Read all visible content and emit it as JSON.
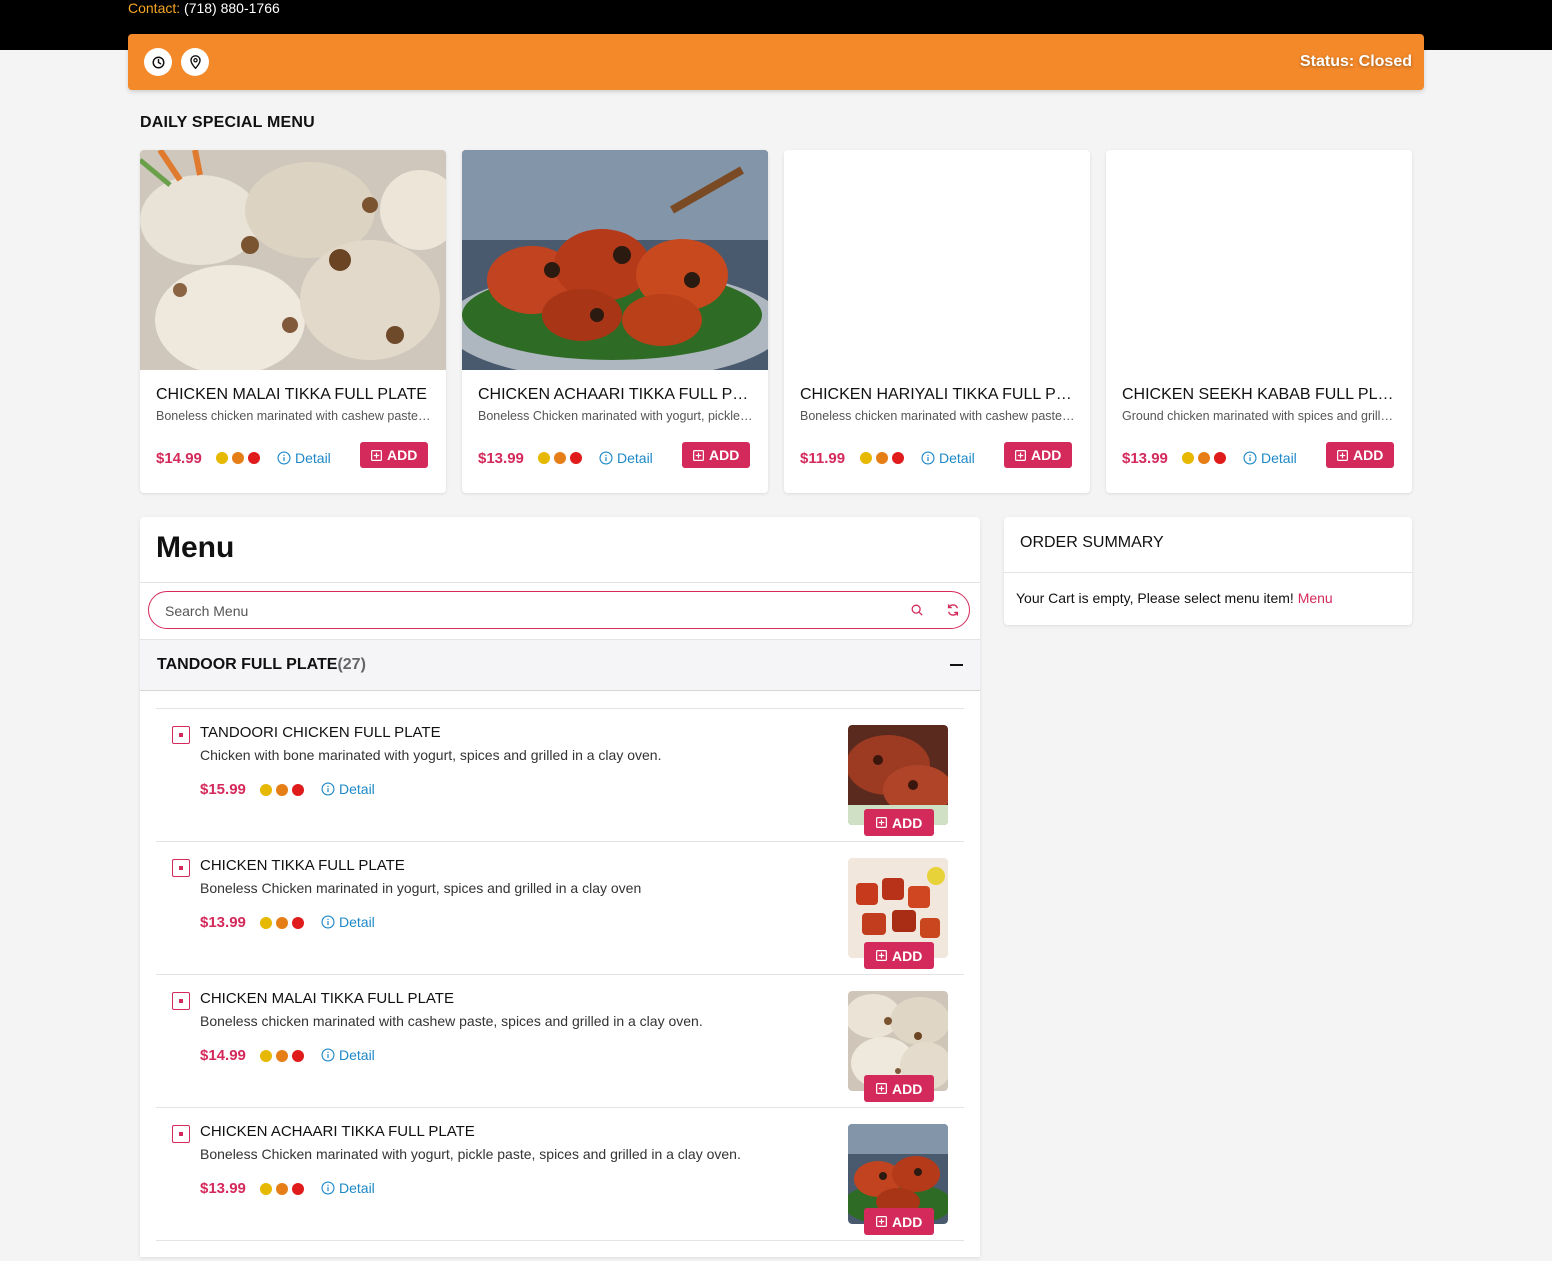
{
  "header": {
    "contact_label": "Contact:",
    "contact_phone": "(718) 880-1766",
    "status": "Status: Closed",
    "icons": [
      "clock-icon",
      "location-pin-icon"
    ]
  },
  "daily_special": {
    "title": "DAILY SPECIAL MENU",
    "items": [
      {
        "name": "CHICKEN MALAI TIKKA FULL PLATE",
        "desc": "Boneless chicken marinated with cashew paste, spices and grilled in a clay oven.",
        "price": "$14.99",
        "detail": "Detail",
        "add": "ADD"
      },
      {
        "name": "CHICKEN ACHAARI TIKKA FULL PLATE",
        "desc": "Boneless Chicken marinated with yogurt, pickle paste, spices and grilled in a clay oven.",
        "price": "$13.99",
        "detail": "Detail",
        "add": "ADD"
      },
      {
        "name": "CHICKEN HARIYALI TIKKA FULL PLATE",
        "desc": "Boneless chicken marinated with cashew paste, spices and grilled in a clay oven.",
        "price": "$11.99",
        "detail": "Detail",
        "add": "ADD"
      },
      {
        "name": "CHICKEN SEEKH KABAB FULL PLATE",
        "desc": "Ground chicken marinated with spices and grilled in a clay oven.",
        "price": "$13.99",
        "detail": "Detail",
        "add": "ADD"
      }
    ]
  },
  "menu": {
    "title": "Menu",
    "search_placeholder": "Search Menu",
    "category": {
      "name": "TANDOOR FULL PLATE",
      "count": "(27)"
    },
    "items": [
      {
        "name": "TANDOORI CHICKEN FULL PLATE",
        "desc": "Chicken with bone marinated with yogurt, spices and grilled in a clay oven.",
        "price": "$15.99",
        "detail": "Detail",
        "add": "ADD"
      },
      {
        "name": "CHICKEN TIKKA FULL PLATE",
        "desc": "Boneless Chicken marinated in yogurt, spices and grilled in a clay oven",
        "price": "$13.99",
        "detail": "Detail",
        "add": "ADD"
      },
      {
        "name": "CHICKEN MALAI TIKKA FULL PLATE",
        "desc": "Boneless chicken marinated with cashew paste, spices and grilled in a clay oven.",
        "price": "$14.99",
        "detail": "Detail",
        "add": "ADD"
      },
      {
        "name": "CHICKEN ACHAARI TIKKA FULL PLATE",
        "desc": "Boneless Chicken marinated with yogurt, pickle paste, spices and grilled in a clay oven.",
        "price": "$13.99",
        "detail": "Detail",
        "add": "ADD"
      }
    ]
  },
  "order_summary": {
    "title": "ORDER SUMMARY",
    "empty_msg": "Your Cart is empty, Please select menu item!",
    "menu_link": "Menu"
  },
  "colors": {
    "accent": "#d42a5b",
    "status_bar": "#f4892a",
    "spice_dots": [
      "#e6b800",
      "#e67e17",
      "#e01b1b"
    ]
  }
}
